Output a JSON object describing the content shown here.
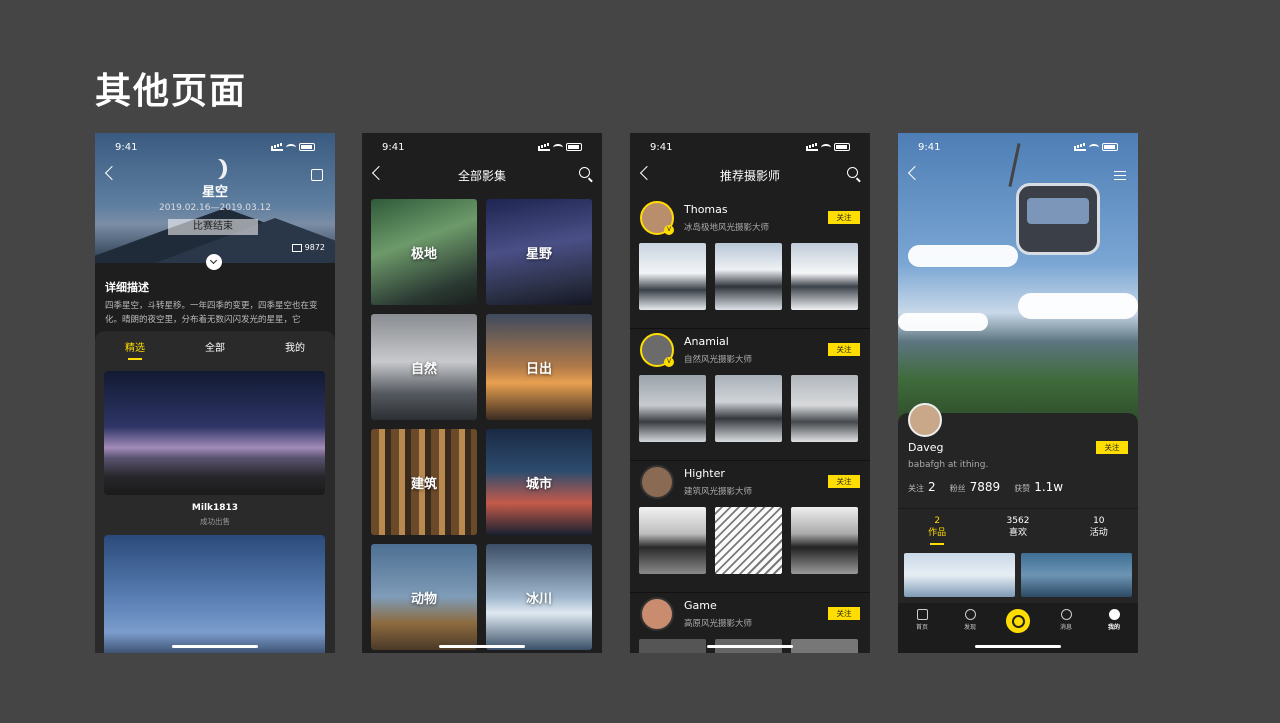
{
  "page": {
    "title": "其他页面"
  },
  "status": {
    "time": "9:41"
  },
  "phone1": {
    "title": "星空",
    "date_range": "2019.02.16—2019.03.12",
    "ended_label": "比赛结束",
    "photo_count": "9872",
    "desc_title": "详细描述",
    "desc": "四季星空，斗转星移。一年四季的变更，四季星空也在变化。晴朗的夜空里，分布着无数闪闪发光的星星，它",
    "tabs": [
      "精选",
      "全部",
      "我的"
    ],
    "card": {
      "title": "Milk1813",
      "subtitle": "成功出售"
    }
  },
  "phone2": {
    "title": "全部影集",
    "tiles": [
      "极地",
      "星野",
      "自然",
      "日出",
      "建筑",
      "城市",
      "动物",
      "冰川"
    ]
  },
  "phone3": {
    "title": "推荐摄影师",
    "follow_label": "关注",
    "badge": "V",
    "photographers": [
      {
        "name": "Thomas",
        "desc": "冰岛极地风光摄影大师"
      },
      {
        "name": "Anamial",
        "desc": "自然风光摄影大师"
      },
      {
        "name": "Highter",
        "desc": "建筑风光摄影大师"
      },
      {
        "name": "Game",
        "desc": "高原风光摄影大师"
      }
    ]
  },
  "phone4": {
    "name": "Daveg",
    "follow_label": "关注",
    "bio": "babafgh at ithing.",
    "stats": [
      {
        "label": "关注",
        "value": "2"
      },
      {
        "label": "粉丝",
        "value": "7889"
      },
      {
        "label": "获赞",
        "value": "1.1w"
      }
    ],
    "tabs": [
      {
        "count": "2",
        "label": "作品"
      },
      {
        "count": "3562",
        "label": "喜欢"
      },
      {
        "count": "10",
        "label": "活动"
      }
    ],
    "nav": [
      "首页",
      "发现",
      "消息",
      "我的"
    ]
  },
  "colors": {
    "accent": "#ffdd00",
    "background": "#454545",
    "phone": "#1e1e1e"
  }
}
